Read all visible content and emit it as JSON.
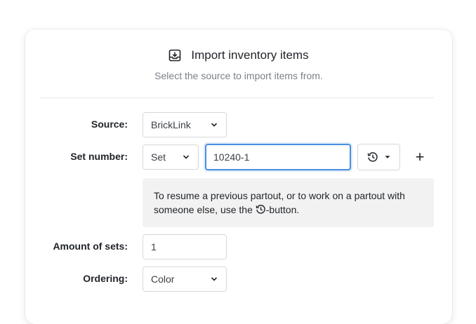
{
  "dialog": {
    "title": "Import inventory items",
    "subtitle": "Select the source to import items from."
  },
  "form": {
    "source": {
      "label": "Source:",
      "value": "BrickLink"
    },
    "set_number": {
      "label": "Set number:",
      "type_value": "Set",
      "number_value": "10240-1"
    },
    "info": {
      "text_before": "To resume a previous partout, or to work on a partout with someone else, use the ",
      "text_after": "-button."
    },
    "amount_of_sets": {
      "label": "Amount of sets:",
      "value": "1"
    },
    "ordering": {
      "label": "Ordering:",
      "value": "Color"
    },
    "add_label": "+"
  },
  "icons": {
    "title": "import-tray-icon",
    "history": "history-icon",
    "caret": "chevron-down-icon"
  },
  "colors": {
    "focus": "#4a8fe0",
    "info_background": "#f2f2f2"
  }
}
